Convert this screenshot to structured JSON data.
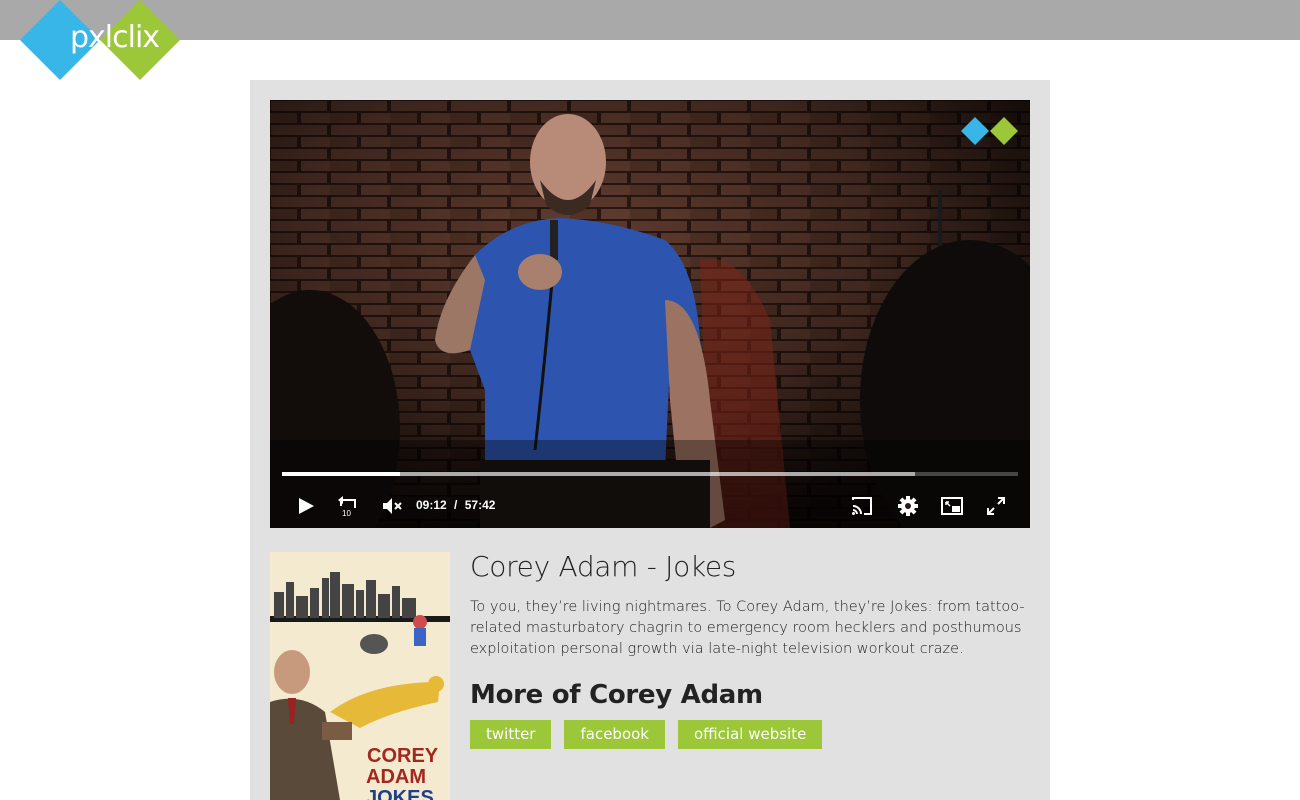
{
  "brand": {
    "logo_text": "pxlclix",
    "color_blue": "#38b6e8",
    "color_green": "#9bc738"
  },
  "player": {
    "current_time": "09:12",
    "separator": "/",
    "duration": "57:42",
    "played_fraction": 0.16,
    "buffered_fraction": 0.86,
    "muted": true,
    "controls": [
      "play-icon",
      "replay-10-icon",
      "mute-icon",
      "cast-icon",
      "settings-icon",
      "miniplayer-icon",
      "fullscreen-icon"
    ]
  },
  "poster": {
    "lines": [
      "COREY",
      "ADAM",
      "JOKES"
    ]
  },
  "video": {
    "title": "Corey Adam - Jokes",
    "description": "To you, they’re living nightmares. To Corey Adam, they’re Jokes: from tattoo-related masturbatory chagrin to emergency room hecklers and posthumous exploitation personal growth via late-night television workout craze."
  },
  "more": {
    "heading": "More of Corey Adam",
    "links": [
      "twitter",
      "facebook",
      "official website"
    ]
  }
}
